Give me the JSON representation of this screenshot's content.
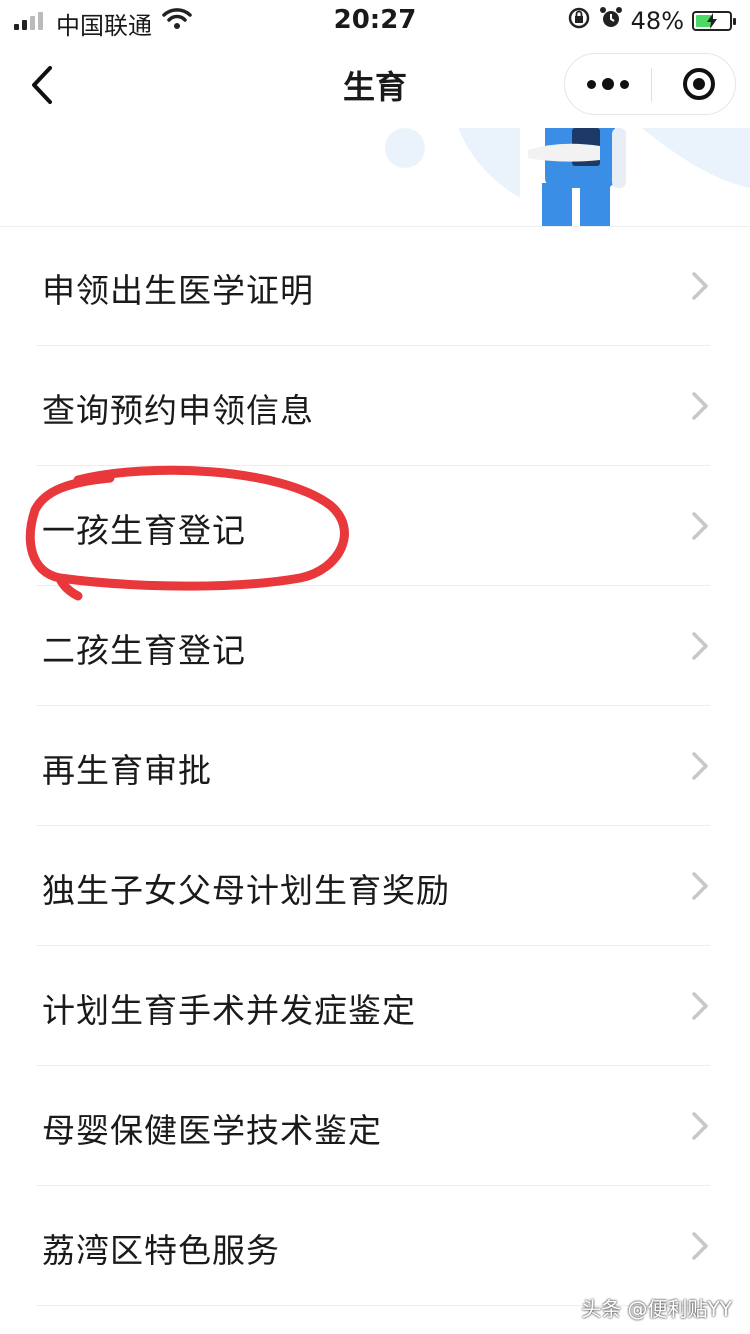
{
  "status_bar": {
    "carrier": "中国联通",
    "time": "20:27",
    "battery_percent": "48%",
    "battery_level": 0.48
  },
  "nav": {
    "title": "生育"
  },
  "menu_items": [
    {
      "label": "申领出生医学证明"
    },
    {
      "label": "查询预约申领信息"
    },
    {
      "label": "一孩生育登记"
    },
    {
      "label": "二孩生育登记"
    },
    {
      "label": "再生育审批"
    },
    {
      "label": "独生子女父母计划生育奖励"
    },
    {
      "label": "计划生育手术并发症鉴定"
    },
    {
      "label": "母婴保健医学技术鉴定"
    },
    {
      "label": "荔湾区特色服务"
    }
  ],
  "annotation": {
    "circled_item": "一孩生育登记",
    "color": "#e8383b"
  },
  "colors": {
    "banner_blue": "#3a8ee6",
    "banner_light": "#eaf3fb",
    "chevron": "#c8c8c8"
  },
  "icons": [
    "signal-icon",
    "wifi-icon",
    "lock-rotation-icon",
    "alarm-icon",
    "battery-icon",
    "back-chevron-icon",
    "more-icon",
    "close-target-icon",
    "chevron-right-icon"
  ],
  "watermark": "头条 @便利贴YY"
}
